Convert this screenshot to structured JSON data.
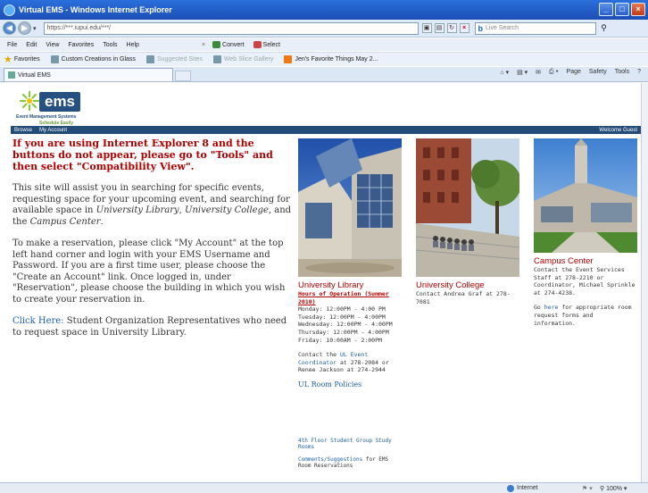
{
  "window": {
    "title": "Virtual EMS - Windows Internet Explorer"
  },
  "address_bar": {
    "url": "https://***.iupui.edu/***/",
    "search_placeholder": "Live Search"
  },
  "menu": {
    "items": [
      "File",
      "Edit",
      "View",
      "Favorites",
      "Tools",
      "Help"
    ],
    "convert_label": "Convert",
    "select_label": "Select"
  },
  "favorites": {
    "label": "Favorites",
    "items": [
      {
        "label": "Custom Creations in Glass"
      },
      {
        "label": "Suggested Sites"
      },
      {
        "label": "Web Slice Gallery"
      },
      {
        "label": "Jen's Favorite Things May 2..."
      }
    ]
  },
  "tab": {
    "label": "Virtual EMS"
  },
  "commandbar": {
    "items": [
      "Page",
      "Safety",
      "Tools"
    ]
  },
  "logo": {
    "text": "ems",
    "line1": "Event Management Systems",
    "line2": "Schedule Easily"
  },
  "sitenav": {
    "browse": "Browse",
    "my_account": "My Account",
    "welcome": "Welcome Guest"
  },
  "main": {
    "warning": "If you are using Internet Explorer 8 and the buttons do not appear, please go to \"Tools\" and then select \"Compatibility View\".",
    "para1_a": "This site will assist you in searching for specific events, requesting space for your upcoming event, and searching for available space in ",
    "para1_ul": "University Library",
    "para1_b": ", ",
    "para1_uc": "University College",
    "para1_c": ", and the ",
    "para1_cc": "Campus Center",
    "para1_d": ".",
    "para2": "To make a reservation, please click \"My Account\" at the top left hand corner and login with your EMS Username and Password. If you are a first time user, please choose the \"Create an Account\" link. Once logged in, under \"Reservation\", please choose the building in which you wish to create your reservation in.",
    "click_here": "Click Here:",
    "para3": " Student Organization Representatives who need to request space in University Library."
  },
  "library": {
    "title": "University Library",
    "hours_head": "Hours of Operation (Summer 2010)",
    "hours": [
      "Monday: 12:00PM - 4:00 PM",
      "Tuesday: 12:00PM - 4:00PM",
      "Wednesday: 12:00PM - 4:00PM",
      "Thursday: 12:00PM - 4:00PM",
      "Friday: 10:00AM - 2:00PM"
    ],
    "contact_a": "Contact the ",
    "contact_link": "UL Event Coordinator",
    "contact_b": " at 278-2084 or Renee Jackson at 274-2944",
    "room_policies": "UL Room Policies",
    "study_rooms": "4th Floor Student Group Study Rooms",
    "comments_link": "Comments/Suggestions",
    "comments_rest": " for EMS Room Reservations"
  },
  "college": {
    "title": "University College",
    "contact": "Contact Andrea Graf at 278-7081"
  },
  "campus": {
    "title": "Campus Center",
    "contact": "Contact the Event Services Staff at 278-2210 or Coordinator, Michael Sprinkle at 274-4238.",
    "go_a": "Go ",
    "go_link": "here",
    "go_b": " for appropriate room request forms and information."
  },
  "status": {
    "zone": "Internet",
    "zoom": "100%"
  },
  "colors": {
    "heading_red": "#b00000",
    "link_blue": "#1c5fa8",
    "nav_blue": "#234d78",
    "ie_title_blue": "#1c4fb5"
  }
}
